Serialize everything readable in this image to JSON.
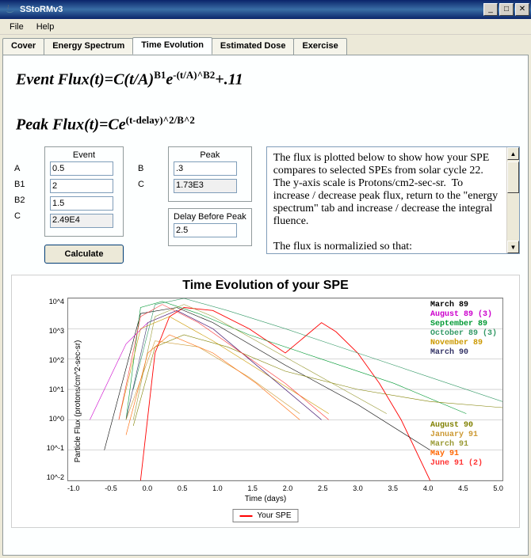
{
  "window": {
    "title": "SStoRMv3"
  },
  "menu": {
    "file": "File",
    "help": "Help"
  },
  "tabs": [
    {
      "label": "Cover"
    },
    {
      "label": "Energy Spectrum"
    },
    {
      "label": "Time Evolution"
    },
    {
      "label": "Estimated Dose"
    },
    {
      "label": "Exercise"
    }
  ],
  "active_tab": 2,
  "formula": {
    "event": "Event Flux(t)=C(t/A)",
    "event_sup1": "B1",
    "event_mid": "e",
    "event_sup2": "-(t/A)^B2",
    "event_tail": "+.11",
    "peak": "Peak Flux(t)=Ce",
    "peak_sup": "(t-delay)^2/B^2"
  },
  "groups": {
    "event_title": "Event",
    "peak_title": "Peak",
    "delay_title": "Delay Before Peak"
  },
  "labels": {
    "A": "A",
    "B1": "B1",
    "B2": "B2",
    "C": "C",
    "B": "B"
  },
  "values": {
    "A": "0.5",
    "B1": "2",
    "B2": "1.5",
    "C_event": "2.49E4",
    "B_peak": ".3",
    "C_peak": "1.73E3",
    "delay": "2.5"
  },
  "buttons": {
    "calculate": "Calculate"
  },
  "info_text": "The flux is plotted below to show how your SPE compares to selected SPEs from solar cycle 22. The y-axis scale is Protons/cm2-sec-sr.  To increase / decrease peak flux, return to the \"energy spectrum\" tab and increase / decrease the integral fluence.\n\nThe flux is normalizied so that:",
  "chart": {
    "title": "Time Evolution of your SPE",
    "xlabel": "Time (days)",
    "ylabel": "Particle Flux (protons/cm^2-sec-sr)",
    "legend": "Your SPE",
    "xticks": [
      "-1.0",
      "-0.5",
      "0.0",
      "0.5",
      "1.0",
      "1.5",
      "2.0",
      "2.5",
      "3.0",
      "3.5",
      "4.0",
      "4.5",
      "5.0"
    ],
    "yticks": [
      "10^4",
      "10^3",
      "10^2",
      "10^1",
      "10^0",
      "10^-1",
      "10^-2"
    ],
    "series_names": [
      {
        "name": "March 89",
        "color": "#000000"
      },
      {
        "name": "August 89 (3)",
        "color": "#cc00cc"
      },
      {
        "name": "September 89",
        "color": "#009933"
      },
      {
        "name": "October 89 (3)",
        "color": "#339966"
      },
      {
        "name": "November 89",
        "color": "#cc9900"
      },
      {
        "name": "March 90",
        "color": "#333366"
      },
      {
        "name": "August 90",
        "color": "#808000"
      },
      {
        "name": "January 91",
        "color": "#cc9933"
      },
      {
        "name": "March 91",
        "color": "#999933"
      },
      {
        "name": "May 91",
        "color": "#ff6600"
      },
      {
        "name": "June 91 (2)",
        "color": "#ff3333"
      }
    ]
  },
  "chart_data": {
    "type": "line",
    "xlabel": "Time (days)",
    "ylabel": "Particle Flux (protons/cm^2-sec-sr)",
    "xlim": [
      -1.0,
      5.0
    ],
    "ylim_log10": [
      -2,
      4
    ],
    "title": "Time Evolution of your SPE",
    "series": [
      {
        "name": "Your SPE",
        "color": "#ff0000",
        "note": "smooth model curve",
        "x": [
          0.0,
          0.2,
          0.4,
          0.6,
          1.0,
          1.5,
          2.0,
          2.3,
          2.5,
          2.7,
          3.0,
          3.3,
          3.6,
          4.0
        ],
        "log10y": [
          -2,
          2.2,
          3.4,
          3.7,
          3.6,
          3.0,
          2.2,
          2.8,
          3.2,
          2.9,
          2.2,
          1.2,
          0.0,
          -2
        ]
      },
      {
        "name": "March 89",
        "color": "#000000",
        "x": [
          -0.5,
          0,
          0.5,
          1,
          2,
          3,
          4
        ],
        "log10y": [
          -1,
          3.5,
          3.7,
          3.2,
          1.8,
          0.5,
          -1
        ]
      },
      {
        "name": "August 89",
        "color": "#cc00cc",
        "x": [
          -0.7,
          -0.2,
          0.1,
          0.5,
          1,
          1.5,
          2,
          2.5
        ],
        "log10y": [
          0,
          2.5,
          3.2,
          3.6,
          3.0,
          2.0,
          1.0,
          0
        ]
      },
      {
        "name": "September 89",
        "color": "#009933",
        "x": [
          -0.2,
          0,
          0.3,
          0.8,
          1.5,
          2.5,
          3.5,
          4.5
        ],
        "log10y": [
          0,
          3.7,
          3.9,
          3.5,
          2.8,
          2.0,
          1.2,
          0.2
        ]
      },
      {
        "name": "October 89",
        "color": "#339966",
        "x": [
          -0.1,
          0.2,
          0.6,
          1.2,
          2,
          3,
          4,
          5
        ],
        "log10y": [
          1,
          3.8,
          4.0,
          3.6,
          3.0,
          2.2,
          1.4,
          0.6
        ]
      },
      {
        "name": "November 89",
        "color": "#cc9900",
        "x": [
          -0.3,
          0,
          0.4,
          1,
          1.8,
          2.6
        ],
        "log10y": [
          0,
          3.0,
          3.4,
          2.6,
          1.4,
          0.2
        ]
      },
      {
        "name": "March 90",
        "color": "#333366",
        "x": [
          -0.2,
          0.1,
          0.5,
          1,
          1.5,
          2,
          2.5
        ],
        "log10y": [
          0,
          3.2,
          3.6,
          3.0,
          2.0,
          1.0,
          0.0
        ]
      },
      {
        "name": "August 90",
        "color": "#808000",
        "x": [
          -0.1,
          0.2,
          0.6,
          1.2,
          2,
          3,
          4,
          5
        ],
        "log10y": [
          -0.2,
          2.4,
          2.8,
          2.4,
          1.6,
          1.0,
          0.6,
          0.4
        ]
      },
      {
        "name": "January 91",
        "color": "#cc9933",
        "x": [
          -0.2,
          0.2,
          0.8,
          1.5,
          2.2
        ],
        "log10y": [
          0,
          2.6,
          2.4,
          1.4,
          0.2
        ]
      },
      {
        "name": "March 91",
        "color": "#999933",
        "x": [
          -0.1,
          0.2,
          0.6,
          1,
          1.6,
          2.2,
          2.8,
          3.4
        ],
        "log10y": [
          0,
          3.4,
          3.8,
          3.4,
          2.6,
          1.8,
          1.0,
          0.2
        ]
      },
      {
        "name": "May 91",
        "color": "#ff6600",
        "x": [
          -0.2,
          0.1,
          0.4,
          1,
          1.6,
          2.2
        ],
        "log10y": [
          -0.5,
          2.2,
          2.8,
          2.2,
          1.2,
          0.0
        ]
      },
      {
        "name": "June 91",
        "color": "#ff3333",
        "x": [
          -0.3,
          0,
          0.3,
          0.8,
          1.4,
          2,
          2.6
        ],
        "log10y": [
          0,
          3.4,
          3.8,
          3.2,
          2.2,
          1.2,
          0.0
        ]
      }
    ]
  }
}
